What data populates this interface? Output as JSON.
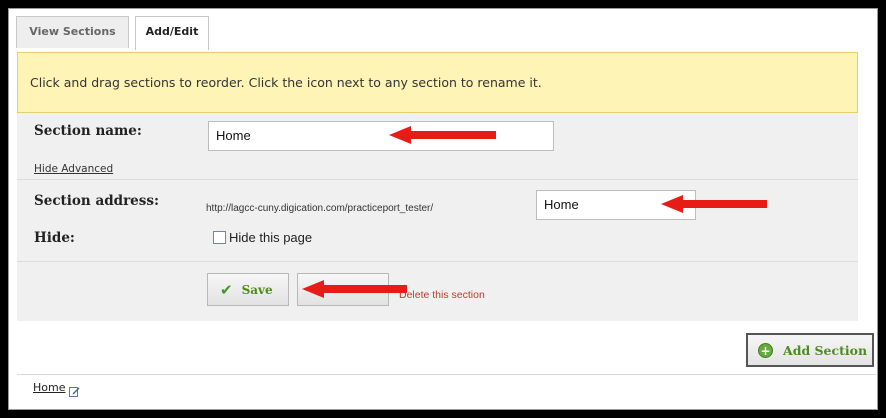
{
  "tabs": [
    {
      "label": "View Sections",
      "active": false
    },
    {
      "label": "Add/Edit",
      "active": true
    }
  ],
  "notice": "Click and drag sections to reorder. Click the icon next to any section to rename it.",
  "form": {
    "section_name_label": "Section name:",
    "section_name_value": "Home",
    "hide_advanced": "Hide Advanced",
    "section_address_label": "Section address:",
    "address_prefix": "http://lagcc-cuny.digication.com/practiceport_tester/",
    "address_value": "Home",
    "hide_label": "Hide:",
    "hide_checkbox_label": "Hide this page",
    "hide_checked": false,
    "save_label": "Save",
    "delete_label": "Delete this section"
  },
  "add_section_label": "Add Section",
  "sections": [
    {
      "label": "Home"
    }
  ],
  "colors": {
    "notice_bg": "#fdf4b6",
    "arrow": "#e81c16",
    "accent_green": "#4d8a1f",
    "delete_red": "#c0392b"
  },
  "icons": [
    "check-icon",
    "plus-circle-icon",
    "edit-icon"
  ]
}
